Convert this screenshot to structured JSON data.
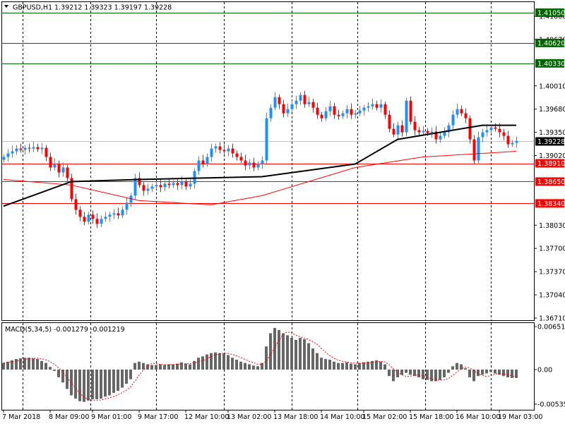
{
  "header": {
    "symbol": "GBPUSD,H1",
    "ohlc": "1.39212 1.39323 1.39197 1.39228"
  },
  "colors": {
    "up": "#1e90ff",
    "down": "#ff0000",
    "ma_slow": "#000000",
    "ma_fast": "#ff0000",
    "support": "#ff0000",
    "resistance": "#006400",
    "hist": "#666666",
    "signal": "#ff0000",
    "grid": "#000000"
  },
  "chart_data": [
    {
      "type": "candlestick",
      "title": "GBPUSD,H1",
      "ylim": [
        1.3671,
        1.4105
      ],
      "y_ticks": [
        "1.41000",
        "1.40670",
        "1.40010",
        "1.39680",
        "1.39350",
        "1.39020",
        "1.38030",
        "1.37700",
        "1.37370",
        "1.37040",
        "1.36710"
      ],
      "y_tick_values": [
        1.41,
        1.4067,
        1.4001,
        1.3968,
        1.3935,
        1.3902,
        1.3803,
        1.377,
        1.3737,
        1.3704,
        1.3671
      ],
      "x_ticks": [
        "7 Mar 2018",
        "8 Mar 09:00",
        "9 Mar 01:00",
        "9 Mar 17:00",
        "12 Mar 10:00",
        "13 Mar 02:00",
        "13 Mar 18:00",
        "14 Mar 10:00",
        "15 Mar 02:00",
        "15 Mar 18:00",
        "16 Mar 10:00",
        "19 Mar 03:00"
      ],
      "x_tick_bars": [
        0,
        11,
        21,
        32,
        43,
        53,
        64,
        75,
        85,
        96,
        107,
        117
      ],
      "grid_bars": [
        4.5,
        20.5,
        36,
        52,
        68,
        83.5,
        99.5,
        115
      ],
      "current_price": {
        "label": "1.39228",
        "value": 1.39228
      },
      "levels": [
        {
          "label": "1.41050",
          "value": 1.4105,
          "kind": "resistance"
        },
        {
          "label": "1.40620",
          "value": 1.4062,
          "kind": "resistance"
        },
        {
          "label": "1.40330",
          "value": 1.4033,
          "kind": "resistance"
        },
        {
          "label": "1.38910",
          "value": 1.3891,
          "kind": "support"
        },
        {
          "label": "1.38650",
          "value": 1.3865,
          "kind": "support"
        },
        {
          "label": "1.38340",
          "value": 1.3834,
          "kind": "support"
        }
      ],
      "close": [
        1.39,
        1.3905,
        1.3908,
        1.3912,
        1.391,
        1.3913,
        1.3912,
        1.3914,
        1.3911,
        1.3913,
        1.39,
        1.3885,
        1.389,
        1.3878,
        1.3885,
        1.387,
        1.384,
        1.3825,
        1.3815,
        1.3808,
        1.3818,
        1.3812,
        1.3805,
        1.3812,
        1.3815,
        1.3818,
        1.382,
        1.3817,
        1.3825,
        1.3835,
        1.3845,
        1.387,
        1.386,
        1.3852,
        1.3855,
        1.3858,
        1.386,
        1.3857,
        1.3862,
        1.386,
        1.3863,
        1.386,
        1.3865,
        1.3858,
        1.3862,
        1.388,
        1.3895,
        1.389,
        1.39,
        1.3912,
        1.3915,
        1.391,
        1.3908,
        1.3912,
        1.3905,
        1.39,
        1.3895,
        1.3888,
        1.3892,
        1.3885,
        1.389,
        1.3895,
        1.3955,
        1.397,
        1.3985,
        1.3975,
        1.3962,
        1.3968,
        1.3975,
        1.398,
        1.3988,
        1.3975,
        1.3978,
        1.397,
        1.396,
        1.3955,
        1.3965,
        1.3972,
        1.396,
        1.3958,
        1.3962,
        1.3968,
        1.396,
        1.3962,
        1.3966,
        1.397,
        1.3972,
        1.3975,
        1.397,
        1.3975,
        1.396,
        1.394,
        1.3932,
        1.3945,
        1.3935,
        1.398,
        1.395,
        1.3938,
        1.3935,
        1.3937,
        1.3934,
        1.3936,
        1.3925,
        1.393,
        1.3935,
        1.3945,
        1.396,
        1.3968,
        1.3962,
        1.3955,
        1.3925,
        1.3895,
        1.3928,
        1.3935,
        1.3938,
        1.3942,
        1.394,
        1.3935,
        1.393,
        1.3918,
        1.392,
        1.39228
      ],
      "ma_slow": [
        [
          0,
          1.383
        ],
        [
          16,
          1.3865
        ],
        [
          32,
          1.3868
        ],
        [
          61,
          1.3872
        ],
        [
          83,
          1.389
        ],
        [
          93,
          1.3925
        ],
        [
          103,
          1.3935
        ],
        [
          113,
          1.3945
        ],
        [
          121,
          1.3945
        ]
      ],
      "ma_fast": [
        [
          0,
          1.3868
        ],
        [
          16,
          1.386
        ],
        [
          32,
          1.3838
        ],
        [
          49,
          1.3832
        ],
        [
          61,
          1.3845
        ],
        [
          83,
          1.3885
        ],
        [
          99,
          1.39
        ],
        [
          113,
          1.3905
        ],
        [
          121,
          1.3908
        ]
      ]
    },
    {
      "type": "bar",
      "title": "MACD(5,34,5) -0.001279 -0.001219",
      "ylim": [
        -0.005353,
        0.006516
      ],
      "y_ticks": [
        "0.006516",
        "0.00",
        "-0.005353"
      ],
      "y_tick_values": [
        0.006516,
        0,
        -0.005353
      ],
      "histogram": [
        0.001,
        0.0012,
        0.0014,
        0.0016,
        0.0017,
        0.0018,
        0.0018,
        0.0017,
        0.0016,
        0.0013,
        0.001,
        0.0004,
        -0.0002,
        -0.0012,
        -0.002,
        -0.003,
        -0.004,
        -0.0045,
        -0.0049,
        -0.005,
        -0.0048,
        -0.0046,
        -0.0046,
        -0.0045,
        -0.0042,
        -0.004,
        -0.0036,
        -0.0033,
        -0.0028,
        -0.0022,
        -0.0015,
        0.001,
        0.0012,
        0.001,
        0.0008,
        0.0007,
        0.0007,
        0.0008,
        0.0007,
        0.0008,
        0.0008,
        0.0009,
        0.0011,
        0.0009,
        0.0008,
        0.0013,
        0.0018,
        0.002,
        0.0023,
        0.0025,
        0.0026,
        0.0025,
        0.0024,
        0.0022,
        0.0018,
        0.0015,
        0.0012,
        0.001,
        0.0008,
        0.0006,
        0.0005,
        0.001,
        0.0035,
        0.0055,
        0.0063,
        0.006,
        0.0055,
        0.0052,
        0.0048,
        0.0045,
        0.0048,
        0.0046,
        0.004,
        0.0032,
        0.0025,
        0.0018,
        0.0016,
        0.0015,
        0.0012,
        0.001,
        0.001,
        0.0011,
        0.0009,
        0.0008,
        0.001,
        0.0011,
        0.0012,
        0.0013,
        0.0014,
        0.0012,
        0.0008,
        -0.001,
        -0.0018,
        -0.0012,
        -0.0008,
        -0.0005,
        -0.0008,
        -0.001,
        -0.0012,
        -0.0015,
        -0.0016,
        -0.0018,
        -0.0018,
        -0.0016,
        -0.0012,
        -0.0005,
        0.0005,
        0.001,
        0.0008,
        0.0002,
        -0.0012,
        -0.0018,
        -0.001,
        -0.0008,
        -0.0006,
        -0.0004,
        -0.0006,
        -0.0008,
        -0.001,
        -0.0012,
        -0.0013,
        -0.0013
      ]
    }
  ]
}
